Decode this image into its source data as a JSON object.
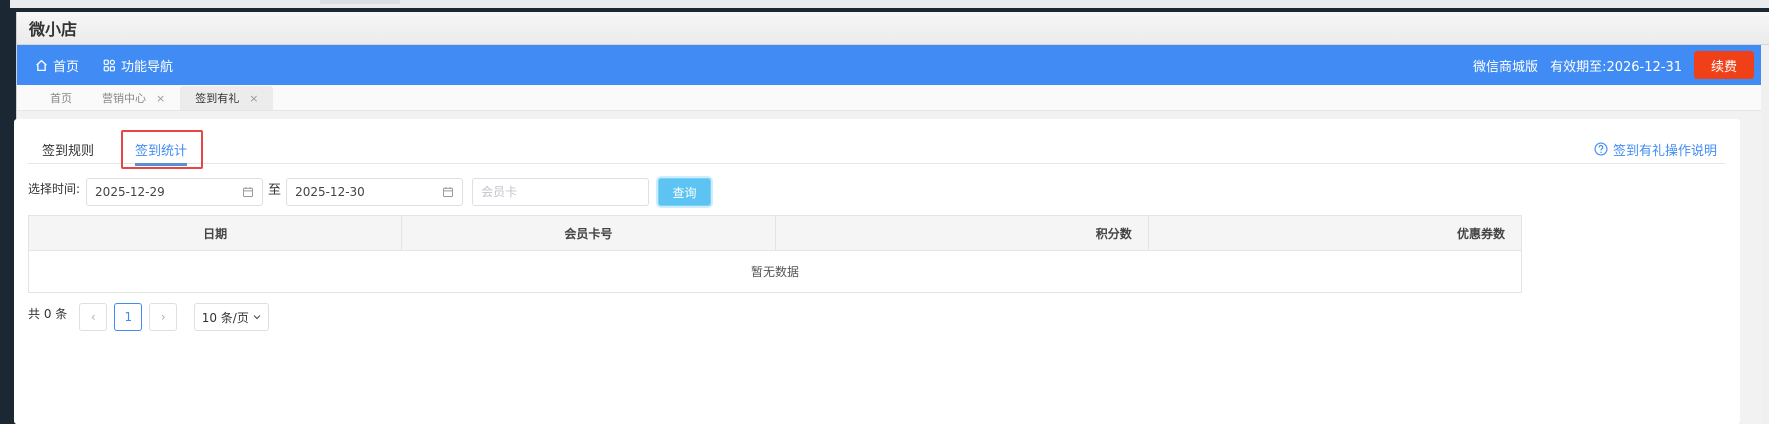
{
  "app": {
    "title": "微小店"
  },
  "nav": {
    "items": [
      {
        "label": "首页",
        "icon": "home-icon"
      },
      {
        "label": "功能导航",
        "icon": "grid-icon"
      }
    ],
    "edition": "微信商城版",
    "expire": "有效期至:2026-12-31",
    "renew_label": "续费"
  },
  "page_tabs": [
    {
      "label": "首页",
      "closable": false,
      "active": false
    },
    {
      "label": "营销中心",
      "closable": true,
      "active": false
    },
    {
      "label": "签到有礼",
      "closable": true,
      "active": true
    }
  ],
  "close_glyph": "×",
  "subtabs": {
    "rules": "签到规则",
    "stats": "签到统计",
    "help": "签到有礼操作说明"
  },
  "filter": {
    "label": "选择时间:",
    "start_date": "2025-12-29",
    "to": "至",
    "end_date": "2025-12-30",
    "card_placeholder": "会员卡",
    "query_label": "查询"
  },
  "table": {
    "columns": [
      "日期",
      "会员卡号",
      "积分数",
      "优惠券数"
    ],
    "empty_text": "暂无数据"
  },
  "pagination": {
    "total": "共 0 条",
    "prev": "‹",
    "current_page": "1",
    "next": "›",
    "page_size": "10 条/页"
  },
  "colors": {
    "nav_blue": "#418cf4",
    "renew_red": "#f04018",
    "query_cyan": "#5cc3f2",
    "highlight_red": "#e84545"
  }
}
